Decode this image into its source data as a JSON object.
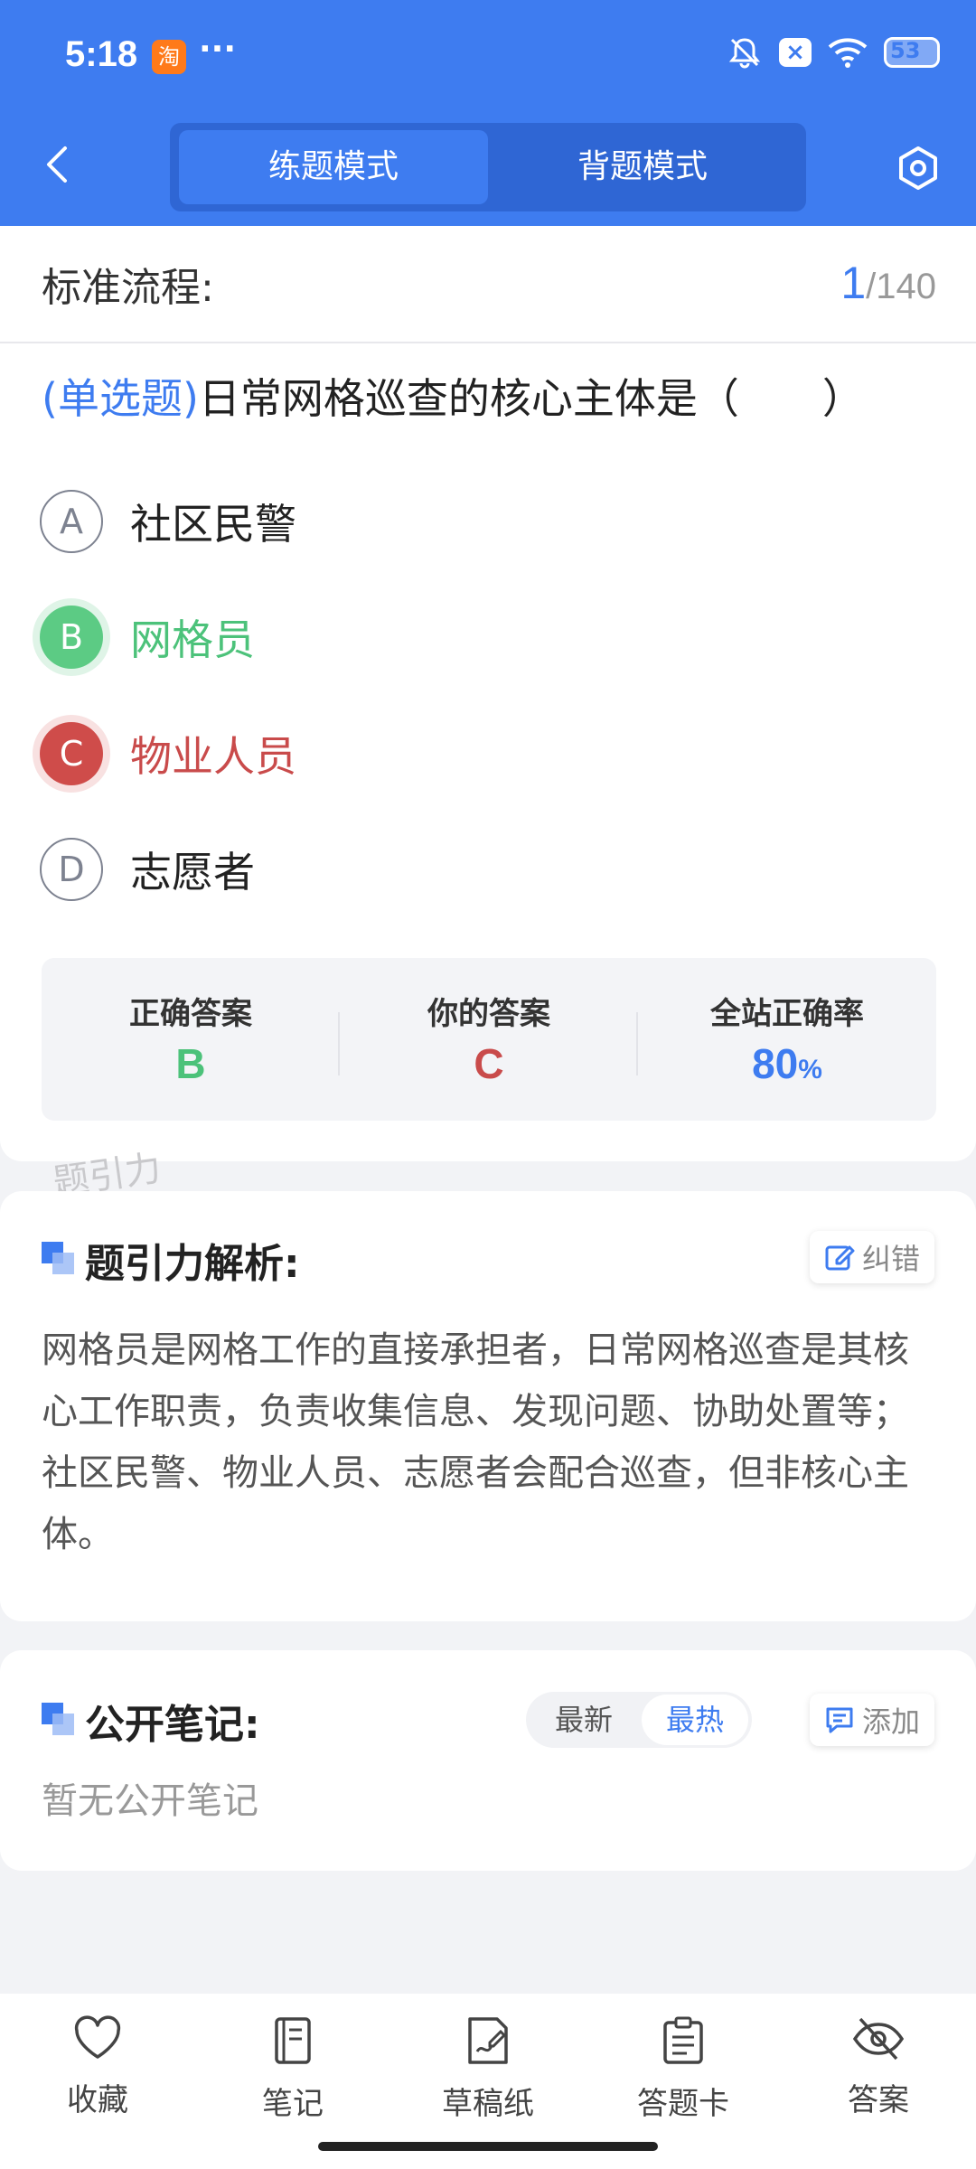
{
  "status_bar": {
    "time": "5:18",
    "app_badge": "淘",
    "more": "···",
    "battery": "53"
  },
  "header": {
    "tabs": [
      {
        "label": "练题模式"
      },
      {
        "label": "背题模式"
      }
    ]
  },
  "question_card": {
    "section_title": "标准流程:",
    "counter_current": "1",
    "counter_total": "/140",
    "question_type": "(单选题)",
    "question_text": "日常网格巡查的核心主体是（　　）",
    "options": [
      {
        "letter": "A",
        "text": "社区民警",
        "state": "normal"
      },
      {
        "letter": "B",
        "text": "网格员",
        "state": "correct"
      },
      {
        "letter": "C",
        "text": "物业人员",
        "state": "wrong"
      },
      {
        "letter": "D",
        "text": "志愿者",
        "state": "normal"
      }
    ],
    "stats": {
      "correct_label": "正确答案",
      "correct_value": "B",
      "yours_label": "你的答案",
      "yours_value": "C",
      "rate_label": "全站正确率",
      "rate_value": "80",
      "rate_unit": "%"
    },
    "watermark": "题引力"
  },
  "analysis": {
    "title": "题引力解析:",
    "correct_button": "纠错",
    "body": "网格员是网格工作的直接承担者，日常网格巡查是其核心工作职责，负责收集信息、发现问题、协助处置等；社区民警、物业人员、志愿者会配合巡查，但非核心主体。"
  },
  "notes": {
    "title": "公开笔记:",
    "sort_latest": "最新",
    "sort_hot": "最热",
    "add_button": "添加",
    "empty": "暂无公开笔记"
  },
  "bottom_nav": [
    {
      "label": "收藏",
      "icon": "heart-icon"
    },
    {
      "label": "笔记",
      "icon": "notebook-icon"
    },
    {
      "label": "草稿纸",
      "icon": "draft-icon"
    },
    {
      "label": "答题卡",
      "icon": "clipboard-icon"
    },
    {
      "label": "答案",
      "icon": "eye-off-icon"
    }
  ],
  "colors": {
    "primary": "#3e7cf0",
    "correct": "#4cc27a",
    "wrong": "#c94b4b"
  }
}
